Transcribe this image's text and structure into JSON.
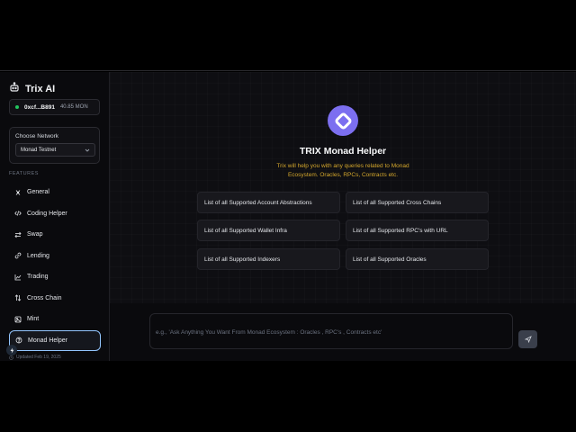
{
  "brand": {
    "name": "Trix AI"
  },
  "wallet": {
    "address": "0xcf...B891",
    "balance": "40.85 MON"
  },
  "network": {
    "label": "Choose Network",
    "selected": "Monad Testnet"
  },
  "sidebar": {
    "features_label": "FEATURES",
    "items": [
      {
        "label": "General",
        "icon": "brain-icon"
      },
      {
        "label": "Coding Helper",
        "icon": "code-icon"
      },
      {
        "label": "Swap",
        "icon": "swap-icon"
      },
      {
        "label": "Lending",
        "icon": "link-icon"
      },
      {
        "label": "Trading",
        "icon": "chart-icon"
      },
      {
        "label": "Cross Chain",
        "icon": "arrows-icon"
      },
      {
        "label": "Mint",
        "icon": "image-icon"
      },
      {
        "label": "Monad Helper",
        "icon": "help-circle-icon"
      }
    ],
    "active_index": 7,
    "updated": "Updated Feb 19, 2025"
  },
  "main": {
    "title": "TRIX Monad Helper",
    "subtitle": "Trix will help you with any queries related to Monad Ecosystem. Oracles, RPCs, Contracts etc.",
    "suggestions": [
      "List of all Supported Account Abstractions",
      "List of all Supported Cross Chains",
      "List of all Supported Wallet Infra",
      "List of all Supported RPC's with URL",
      "List of all Supported Indexers",
      "List of all Supported Oracles"
    ]
  },
  "composer": {
    "placeholder": "e.g., 'Ask Anything You Want From Monad Ecosystem : Oracles , RPC's , Contracts etc'"
  },
  "colors": {
    "accent": "#7c6ff0",
    "subtitle": "#d4a72c",
    "active_border": "#93c5fd",
    "status": "#22c55e"
  }
}
